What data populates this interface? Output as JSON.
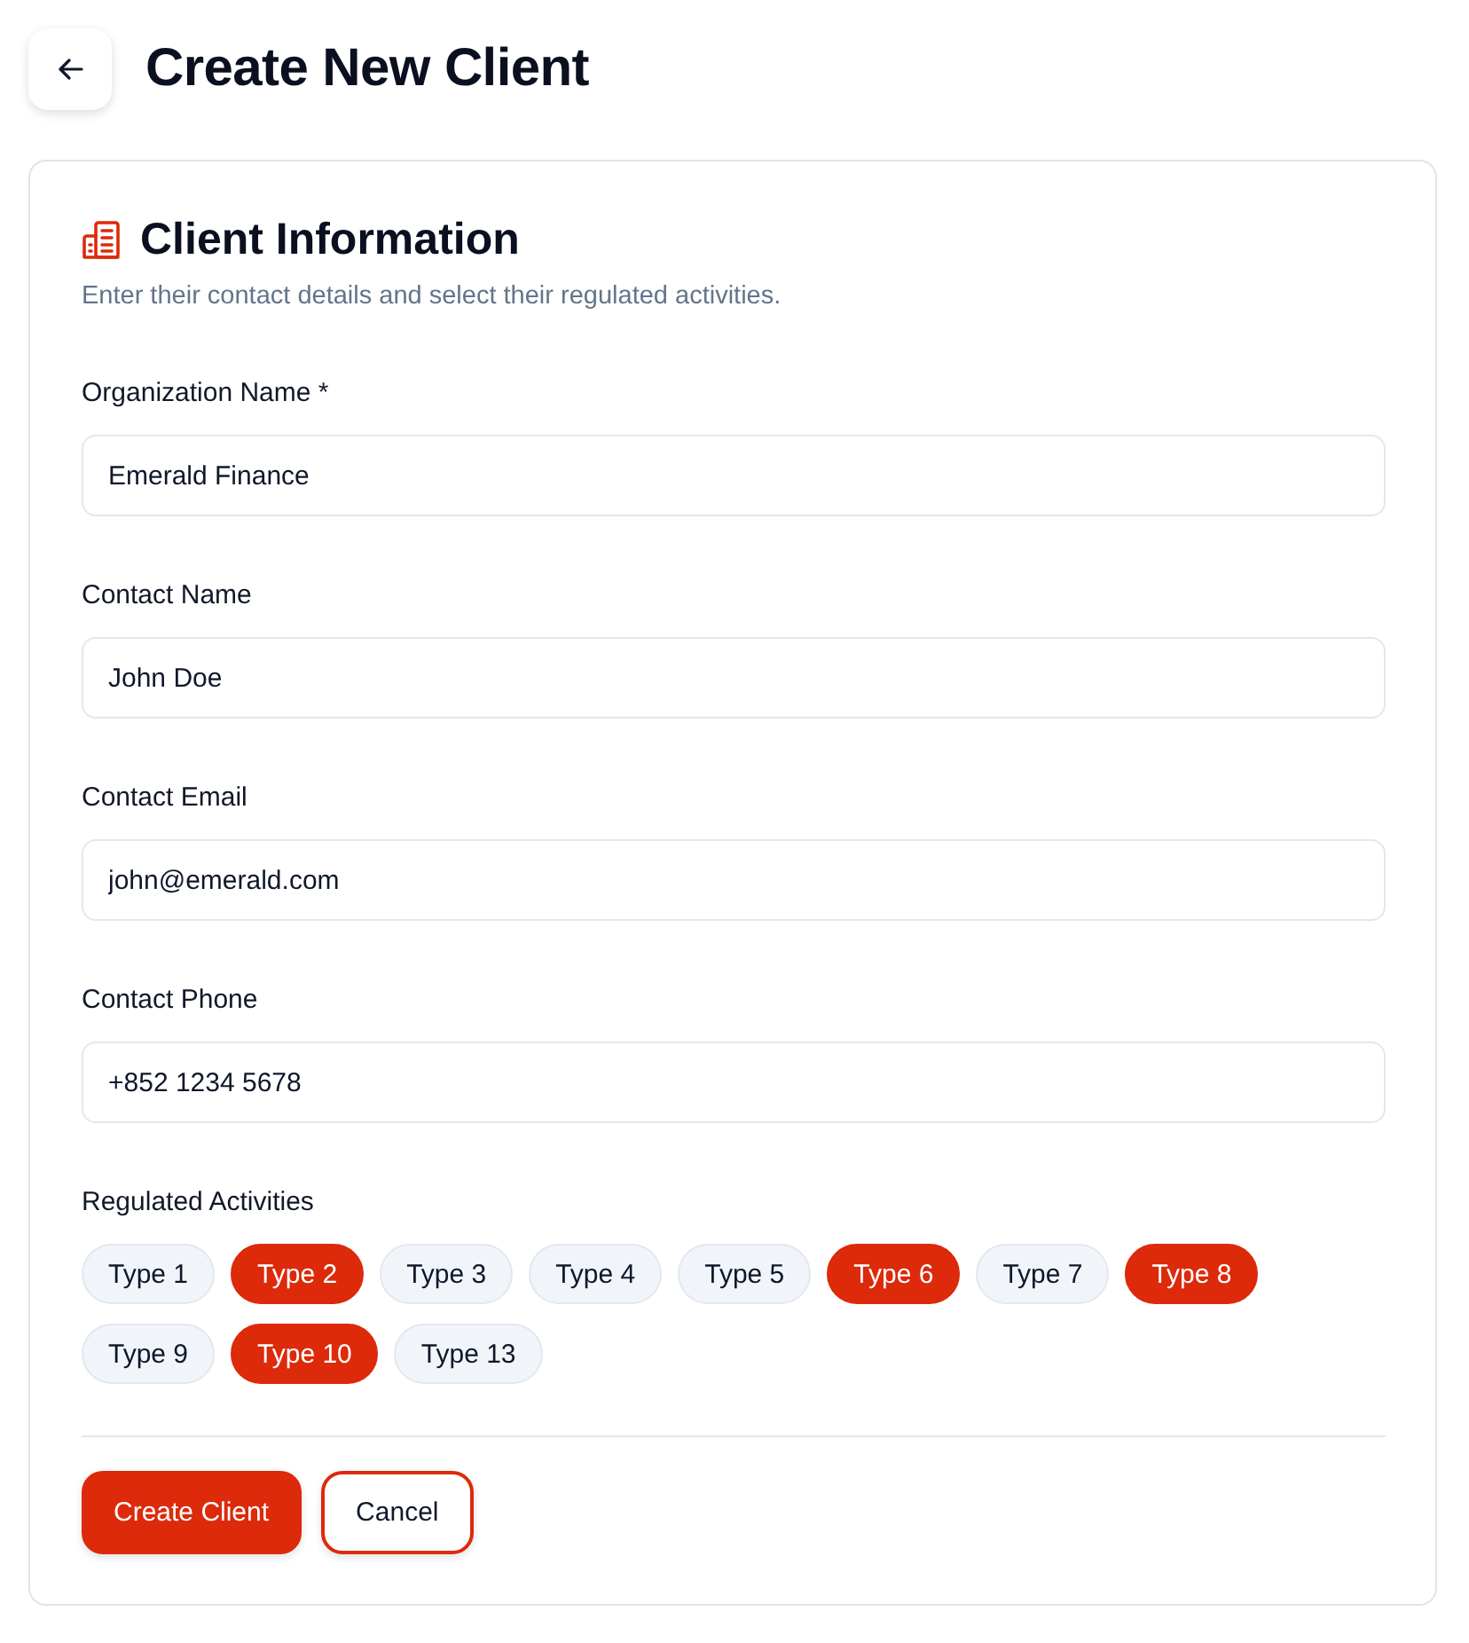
{
  "header": {
    "title": "Create New Client"
  },
  "section": {
    "title": "Client Information",
    "subtitle": "Enter their contact details and select their regulated activities."
  },
  "fields": [
    {
      "label": "Organization Name *",
      "value": "Emerald Finance"
    },
    {
      "label": "Contact Name",
      "value": "John Doe"
    },
    {
      "label": "Contact Email",
      "value": "john@emerald.com"
    },
    {
      "label": "Contact Phone",
      "value": "+852 1234 5678"
    }
  ],
  "activities": {
    "label": "Regulated Activities",
    "options": [
      {
        "label": "Type 1",
        "selected": false
      },
      {
        "label": "Type 2",
        "selected": true
      },
      {
        "label": "Type 3",
        "selected": false
      },
      {
        "label": "Type 4",
        "selected": false
      },
      {
        "label": "Type 5",
        "selected": false
      },
      {
        "label": "Type 6",
        "selected": true
      },
      {
        "label": "Type 7",
        "selected": false
      },
      {
        "label": "Type 8",
        "selected": true
      },
      {
        "label": "Type 9",
        "selected": false
      },
      {
        "label": "Type 10",
        "selected": true
      },
      {
        "label": "Type 13",
        "selected": false
      }
    ]
  },
  "buttons": [
    {
      "label": "Create Client",
      "kind": "primary"
    },
    {
      "label": "Cancel",
      "kind": "outline"
    }
  ]
}
